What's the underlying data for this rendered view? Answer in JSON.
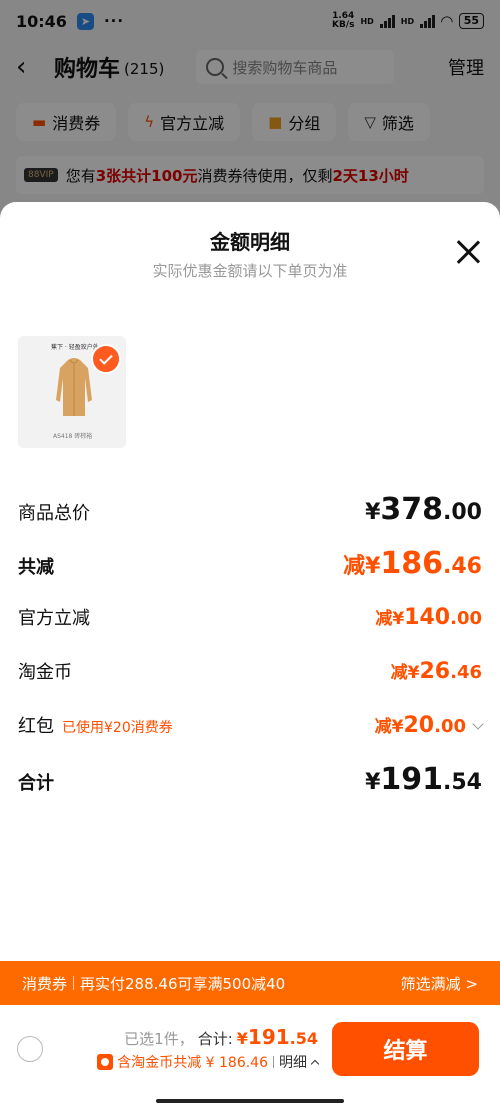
{
  "status_bar": {
    "time": "10:46",
    "net_speed": "1.64",
    "net_unit": "KB/s",
    "hd1": "HD",
    "hd2": "HD",
    "battery": "55"
  },
  "header": {
    "title": "购物车",
    "count": "(215)",
    "search_placeholder": "搜索购物车商品",
    "manage_label": "管理"
  },
  "filters": [
    {
      "label": "消费券",
      "icon": "ticket-icon"
    },
    {
      "label": "官方立减",
      "icon": "lightning-icon"
    },
    {
      "label": "分组",
      "icon": "folder-icon"
    },
    {
      "label": "筛选",
      "icon": "filter-icon"
    }
  ],
  "notice": {
    "badge": "88VIP",
    "pre": "您有",
    "highlight1": "3张共计100元",
    "mid": "消费券待使用，仅剩",
    "highlight2": "2天13小时"
  },
  "sheet": {
    "title": "金额明细",
    "subtitle": "实际优惠金额请以下单页为准",
    "product": {
      "brand": "蕉下 · 轻盈玫户外",
      "sku": "AS418 砖棕裕"
    },
    "rows": {
      "total": {
        "label": "商品总价",
        "symbol": "¥",
        "integer": "378",
        "decimal": ".00"
      },
      "reduce": {
        "label": "共减",
        "prefix": "减",
        "symbol": "¥",
        "integer": "186",
        "decimal": ".46"
      },
      "official": {
        "label": "官方立减",
        "prefix": "减",
        "symbol": "¥",
        "integer": "140",
        "decimal": ".00"
      },
      "coin": {
        "label": "淘金币",
        "prefix": "减",
        "symbol": "¥",
        "integer": "26",
        "decimal": ".46"
      },
      "hongbao": {
        "label": "红包",
        "note": "已使用¥20消费券",
        "prefix": "减",
        "symbol": "¥",
        "integer": "20",
        "decimal": ".00"
      },
      "sum": {
        "label": "合计",
        "symbol": "¥",
        "integer": "191",
        "decimal": ".54"
      }
    }
  },
  "coupon_bar": {
    "label": "消费券",
    "text": "再实付288.46可享满500减40",
    "action": "筛选满减 >"
  },
  "checkout": {
    "selected": "已选1件，",
    "total_label": "合计:",
    "total_symbol": "¥",
    "total_int": "191",
    "total_dec": ".54",
    "coin_text": "含淘金币共减 ¥ 186.46",
    "detail": "明细",
    "pay_label": "结算"
  },
  "colors": {
    "accent": "#ff5000",
    "coupon_bar": "#ff6a00"
  }
}
